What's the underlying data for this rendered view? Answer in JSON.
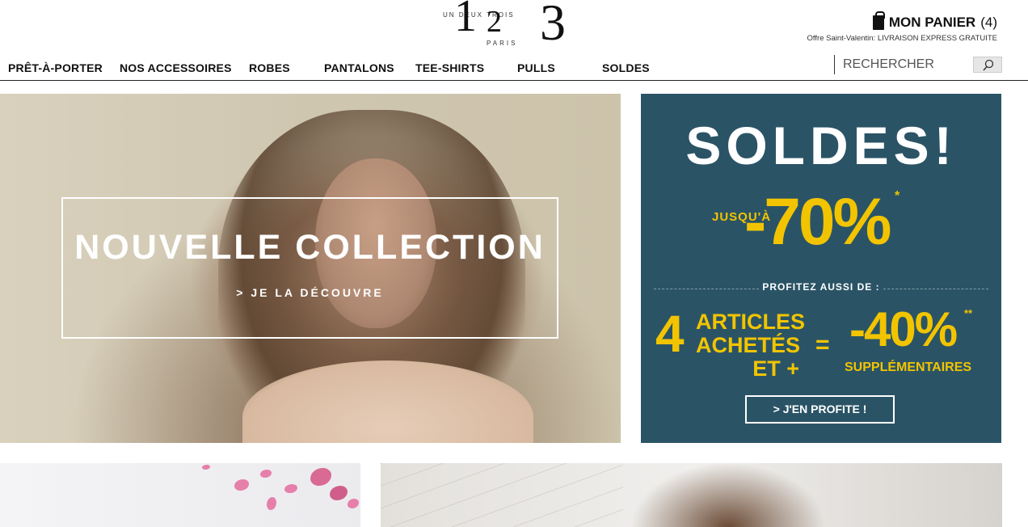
{
  "logo": {
    "numerals": [
      "1",
      "2",
      "3"
    ],
    "words": "UN DEUX TROIS",
    "city": "PARIS"
  },
  "cart": {
    "label": "MON PANIER",
    "count": "(4)",
    "offer": "Offre Saint-Valentin: LIVRAISON EXPRESS GRATUITE"
  },
  "nav": {
    "items": [
      "PRÊT-À-PORTER",
      "NOS ACCESSOIRES",
      "ROBES",
      "PANTALONS",
      "TEE-SHIRTS",
      "PULLS",
      "SOLDES"
    ]
  },
  "search": {
    "placeholder": "RECHERCHER"
  },
  "hero": {
    "title": "NOUVELLE COLLECTION",
    "cta": "> JE LA DÉCOUVRE"
  },
  "sale": {
    "headline": "SOLDES!",
    "upto": "JUSQU'À",
    "percent": "-70%",
    "asterisk": "*",
    "subtitle": "PROFITEZ AUSSI DE :",
    "number": "4",
    "lines": [
      "ARTICLES",
      "ACHETÉS",
      "ET +"
    ],
    "equals": "=",
    "percent2": "-40%",
    "asterisk2": "**",
    "extra": "SUPPLÉMENTAIRES",
    "button": "> J'EN PROFITE !"
  },
  "colors": {
    "sale_bg": "#2a5466",
    "sale_accent": "#f2c400"
  }
}
